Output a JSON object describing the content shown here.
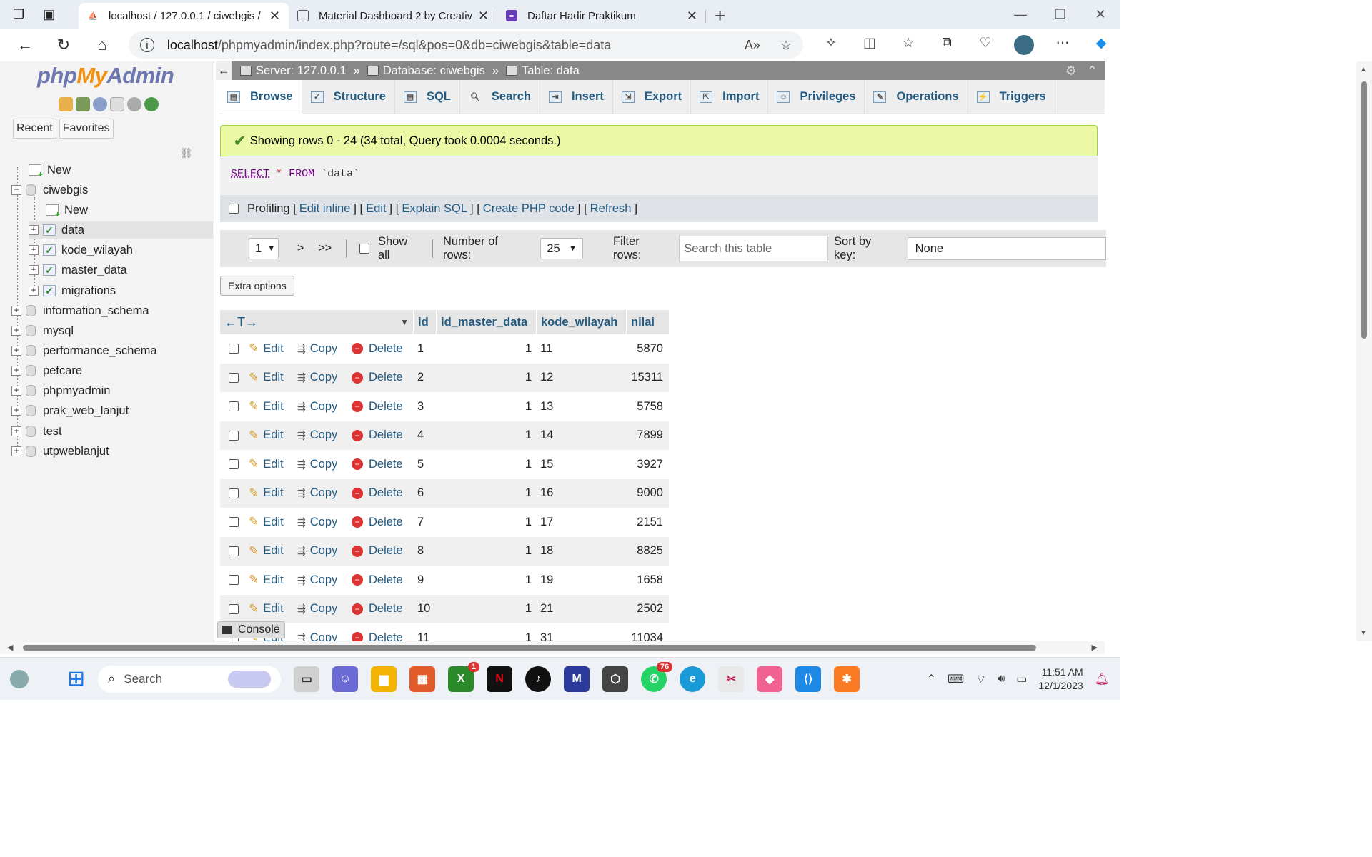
{
  "browser": {
    "tabs": [
      {
        "title": "localhost / 127.0.0.1 / ciwebgis / ",
        "active": true
      },
      {
        "title": "Material Dashboard 2 by Creative",
        "active": false
      },
      {
        "title": "Daftar Hadir Praktikum",
        "active": false
      }
    ],
    "url_host": "localhost",
    "url_path": "/phpmyadmin/index.php?route=/sql&pos=0&db=ciwebgis&table=data"
  },
  "pma": {
    "logo_php": "php",
    "logo_my": "My",
    "logo_admin": "Admin",
    "recent": "Recent",
    "favorites": "Favorites",
    "tree": [
      {
        "label": "New",
        "kind": "new",
        "level": 0
      },
      {
        "label": "ciwebgis",
        "kind": "db",
        "level": 0,
        "expanded": true
      },
      {
        "label": "New",
        "kind": "new",
        "level": 1
      },
      {
        "label": "data",
        "kind": "table",
        "level": 1,
        "selected": true
      },
      {
        "label": "kode_wilayah",
        "kind": "table",
        "level": 1
      },
      {
        "label": "master_data",
        "kind": "table",
        "level": 1
      },
      {
        "label": "migrations",
        "kind": "table",
        "level": 1
      },
      {
        "label": "information_schema",
        "kind": "db",
        "level": 0
      },
      {
        "label": "mysql",
        "kind": "db",
        "level": 0
      },
      {
        "label": "performance_schema",
        "kind": "db",
        "level": 0
      },
      {
        "label": "petcare",
        "kind": "db",
        "level": 0
      },
      {
        "label": "phpmyadmin",
        "kind": "db",
        "level": 0
      },
      {
        "label": "prak_web_lanjut",
        "kind": "db",
        "level": 0
      },
      {
        "label": "test",
        "kind": "db",
        "level": 0
      },
      {
        "label": "utpweblanjut",
        "kind": "db",
        "level": 0
      }
    ],
    "breadcrumb": {
      "server": "Server: 127.0.0.1",
      "database": "Database: ciwebgis",
      "table": "Table: data"
    },
    "menu": [
      "Browse",
      "Structure",
      "SQL",
      "Search",
      "Insert",
      "Export",
      "Import",
      "Privileges",
      "Operations",
      "Triggers"
    ],
    "success": "Showing rows 0 - 24 (34 total, Query took 0.0004 seconds.)",
    "sql": {
      "kw1": "SELECT",
      "star": "*",
      "kw2": "FROM",
      "table": "`data`"
    },
    "profiling": {
      "label": "Profiling",
      "links": [
        "Edit inline",
        "Edit",
        "Explain SQL",
        "Create PHP code",
        "Refresh"
      ]
    },
    "nav": {
      "page": "1",
      "next": ">",
      "last": ">>",
      "show_all": "Show all",
      "rows_label": "Number of rows:",
      "rows_value": "25",
      "filter_label": "Filter rows:",
      "filter_placeholder": "Search this table",
      "sort_label": "Sort by key:",
      "sort_value": "None"
    },
    "extra_options": "Extra options",
    "columns": [
      "id",
      "id_master_data",
      "kode_wilayah",
      "nilai"
    ],
    "actions": {
      "edit": "Edit",
      "copy": "Copy",
      "delete": "Delete"
    },
    "rows": [
      {
        "id": "1",
        "id_master_data": "1",
        "kode_wilayah": "11",
        "nilai": "5870"
      },
      {
        "id": "2",
        "id_master_data": "1",
        "kode_wilayah": "12",
        "nilai": "15311"
      },
      {
        "id": "3",
        "id_master_data": "1",
        "kode_wilayah": "13",
        "nilai": "5758"
      },
      {
        "id": "4",
        "id_master_data": "1",
        "kode_wilayah": "14",
        "nilai": "7899"
      },
      {
        "id": "5",
        "id_master_data": "1",
        "kode_wilayah": "15",
        "nilai": "3927"
      },
      {
        "id": "6",
        "id_master_data": "1",
        "kode_wilayah": "16",
        "nilai": "9000"
      },
      {
        "id": "7",
        "id_master_data": "1",
        "kode_wilayah": "17",
        "nilai": "2151"
      },
      {
        "id": "8",
        "id_master_data": "1",
        "kode_wilayah": "18",
        "nilai": "8825"
      },
      {
        "id": "9",
        "id_master_data": "1",
        "kode_wilayah": "19",
        "nilai": "1658"
      },
      {
        "id": "10",
        "id_master_data": "1",
        "kode_wilayah": "21",
        "nilai": "2502"
      },
      {
        "id": "11",
        "id_master_data": "1",
        "kode_wilayah": "31",
        "nilai": "11034"
      }
    ],
    "console": "Console"
  },
  "taskbar": {
    "search": "Search",
    "badges": {
      "xbox": "1",
      "whatsapp": "76"
    },
    "time": "11:51 AM",
    "date": "12/1/2023"
  }
}
